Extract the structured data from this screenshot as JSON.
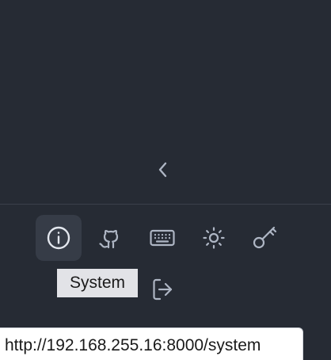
{
  "sidebar": {
    "collapse_icon": "chevron-left-icon",
    "footer_icons": [
      {
        "name": "info-icon",
        "label": "System",
        "active": true
      },
      {
        "name": "github-icon",
        "label": "GitHub",
        "active": false
      },
      {
        "name": "keyboard-icon",
        "label": "Keyboard shortcuts",
        "active": false
      },
      {
        "name": "sun-icon",
        "label": "Theme",
        "active": false
      },
      {
        "name": "key-icon",
        "label": "API keys",
        "active": false
      },
      {
        "name": "logout-icon",
        "label": "Log out",
        "active": false
      }
    ]
  },
  "tooltip": {
    "text": "System"
  },
  "status_bar": {
    "url": "http://192.168.255.16:8000/system"
  },
  "colors": {
    "background": "#262b34",
    "active_button": "#363c47",
    "icon": "#aeb6c4",
    "tooltip_bg": "#e2e3e7"
  }
}
